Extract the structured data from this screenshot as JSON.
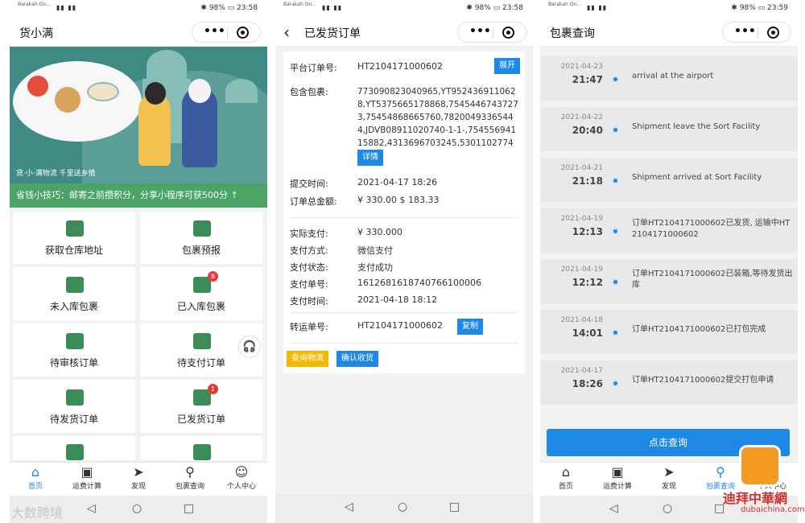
{
  "status": {
    "operator": "Barakah On...",
    "p1": {
      "right": "✱ 98% ▭ 23:58"
    },
    "p2": {
      "right": "✱ 98% ▭ 23:58"
    },
    "p3": {
      "right": "✱ 98% ▭ 23:59"
    }
  },
  "p1": {
    "title": "货小满",
    "banner_caption": "货·小·满物流 千里送乡情",
    "tip": "省钱小技巧：邮寄之前攒积分，分享小程序可获500分 ↑",
    "grid": [
      {
        "label": "获取仓库地址"
      },
      {
        "label": "包裹预报"
      },
      {
        "label": "未入库包裹"
      },
      {
        "label": "已入库包裹",
        "badge": "8"
      },
      {
        "label": "待审核订单"
      },
      {
        "label": "待支付订单"
      },
      {
        "label": "待发货订单"
      },
      {
        "label": "已发货订单",
        "badge": "1"
      }
    ]
  },
  "tabs": {
    "home": "首页",
    "calc": "运费计算",
    "discover": "发现",
    "query": "包裹查询",
    "me": "个人中心"
  },
  "icons": {
    "home": "⌂",
    "calc": "▣",
    "discover": "➤",
    "query": "⚲",
    "me": "☺",
    "more": "•••",
    "back": "‹",
    "support": "🎧"
  },
  "p2": {
    "title": "已发货订单",
    "order_no_label": "平台订单号:",
    "order_no": "HT2104171000602",
    "expand": "展开",
    "packages_label": "包含包裹:",
    "packages": "773090823040965,YT9524369110628,YT5375665178868,75454467437273,75454868665760,78200493365444,JDVB08911020740-1-1-,75455694115882,4313696703245,5301102774004",
    "detail": "详情",
    "submit_time_label": "提交时间:",
    "submit_time": "2021-04-17 18:26",
    "total_label": "订单总金额:",
    "total": "¥ 330.00 $ 183.33",
    "paid_label": "实际支付:",
    "paid": "¥ 330.000",
    "method_label": "支付方式:",
    "method": "微信支付",
    "pay_status_label": "支付状态:",
    "pay_status": "支付成功",
    "pay_no_label": "支付单号:",
    "pay_no": "1612681618740766100006",
    "pay_time_label": "支付时间:",
    "pay_time": "2021-04-18 18:12",
    "transit_label": "转运单号:",
    "transit_no": "HT2104171000602",
    "copy": "复制",
    "track_btn": "查询物流",
    "confirm_btn": "确认收货"
  },
  "p3": {
    "title": "包裹查询",
    "events": [
      {
        "date": "2021-04-23",
        "time": "21:47",
        "text": "arrival at the airport"
      },
      {
        "date": "2021-04-22",
        "time": "20:40",
        "text": "Shipment leave the Sort Facility"
      },
      {
        "date": "2021-04-21",
        "time": "21:18",
        "text": "Shipment arrived at Sort Facility"
      },
      {
        "date": "2021-04-19",
        "time": "12:13",
        "text": "订单HT2104171000602已发货, 运输中HT2104171000602"
      },
      {
        "date": "2021-04-19",
        "time": "12:12",
        "text": "订单HT2104171000602已装箱,等待发货出库"
      },
      {
        "date": "2021-04-18",
        "time": "14:01",
        "text": "订单HT2104171000602已打包完成"
      },
      {
        "date": "2021-04-17",
        "time": "18:26",
        "text": "订单HT2104171000602提交打包申请"
      }
    ],
    "query_button": "点击查询"
  },
  "watermarks": {
    "left": "大数跨境",
    "right": "迪拜中華網",
    "right_url": "dubaichina.com"
  }
}
